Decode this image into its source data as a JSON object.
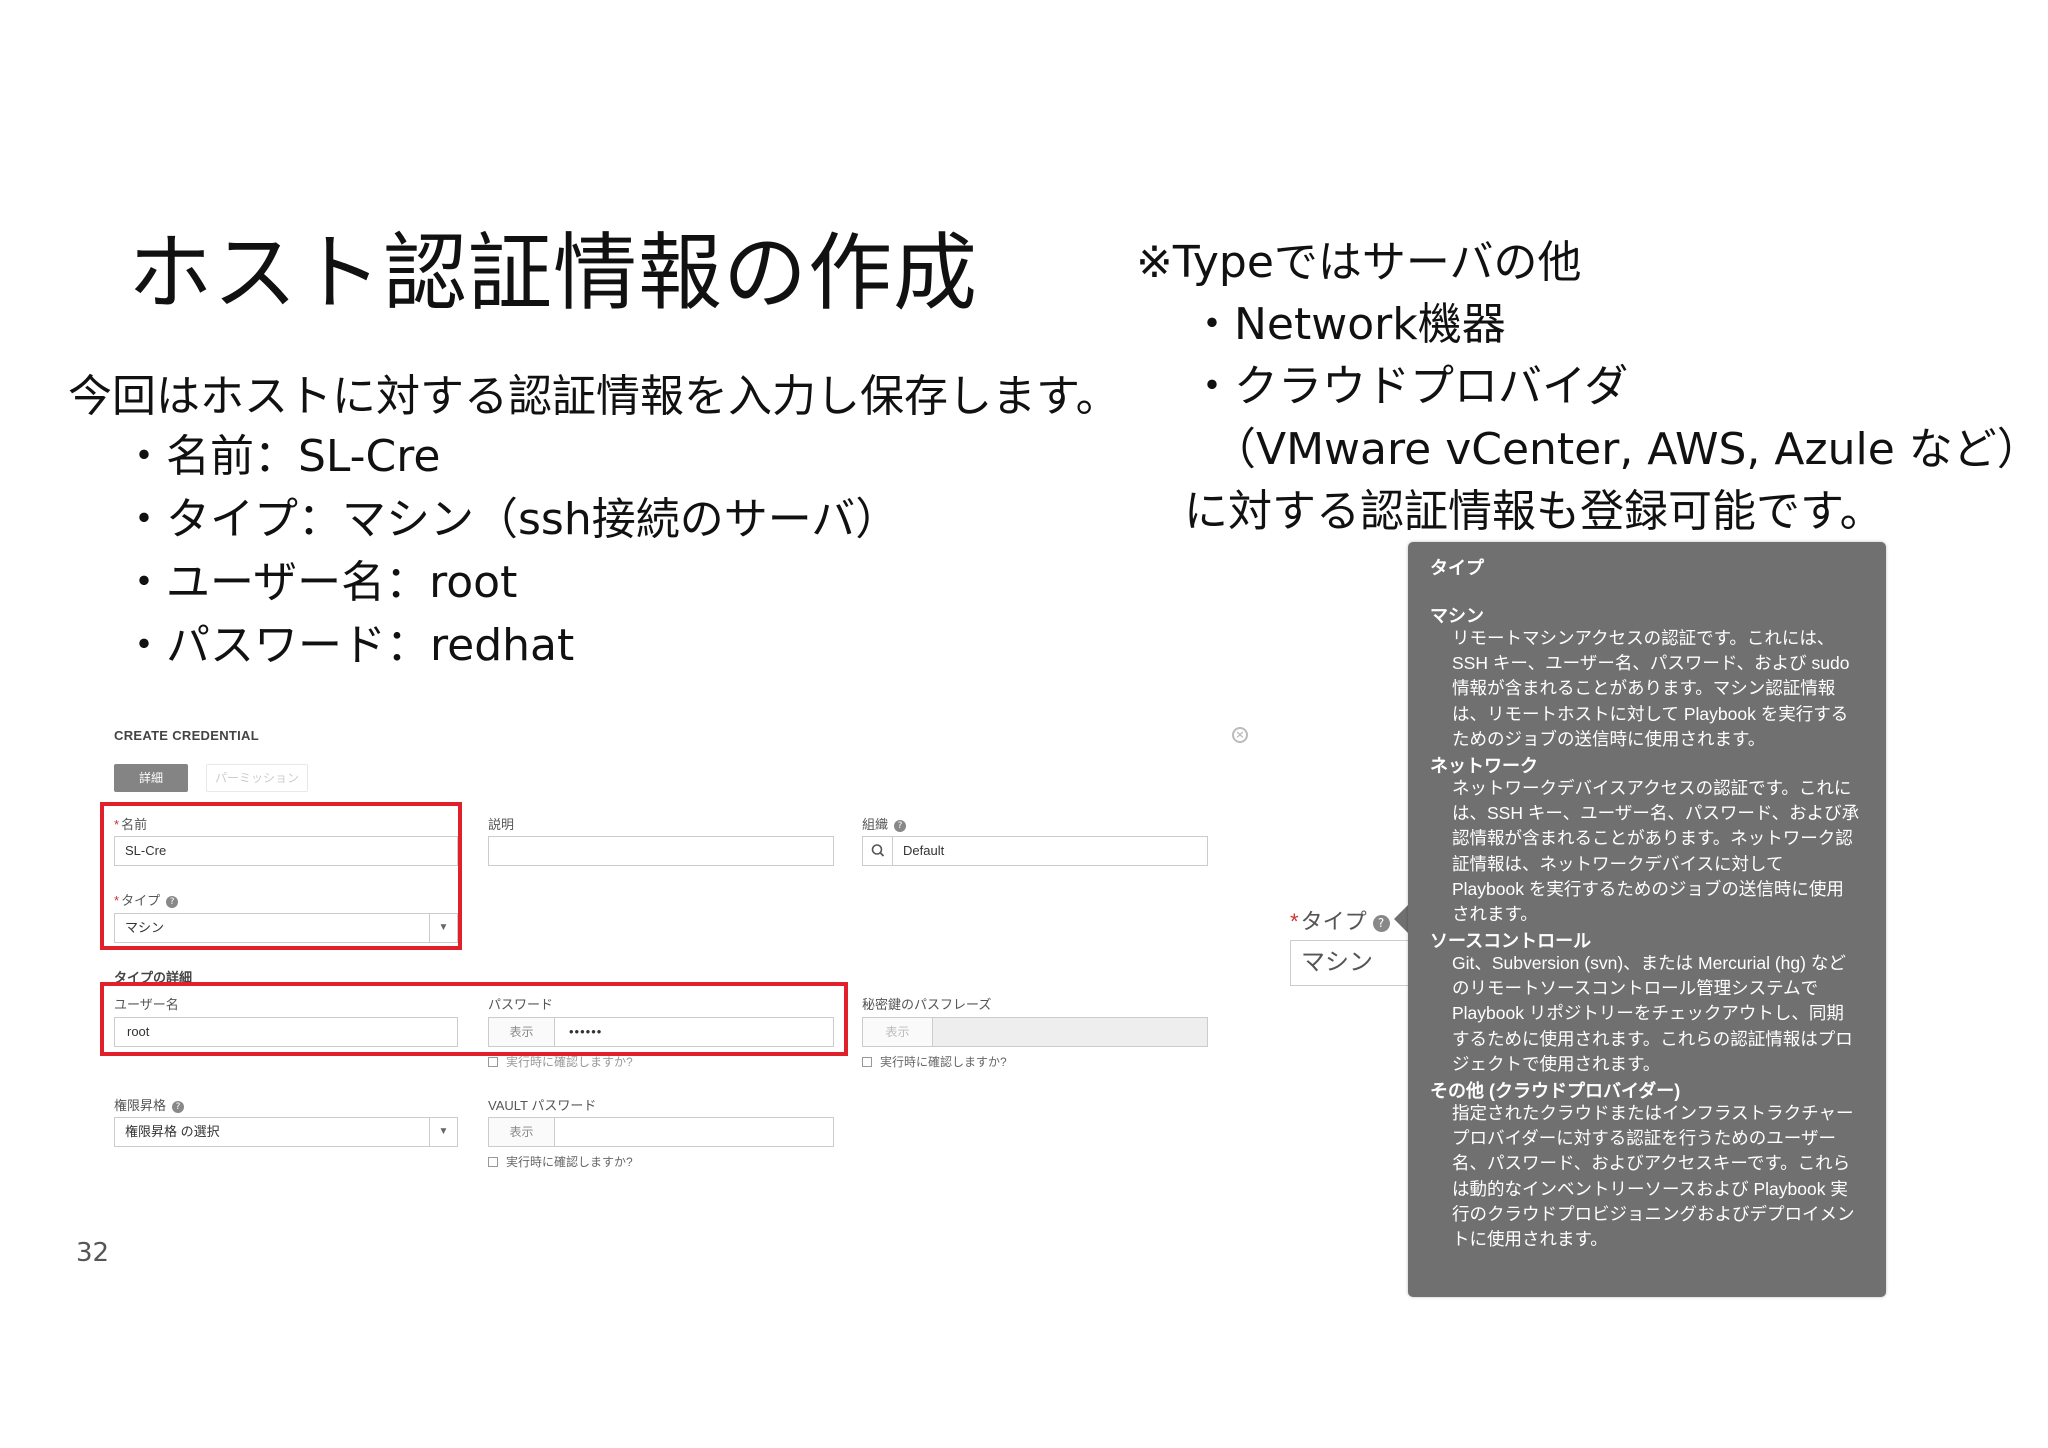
{
  "slide": {
    "title": "ホスト認証情報の作成",
    "intro": "今回はホストに対する認証情報を入力し保存します。",
    "bullets": [
      "・名前：SL-Cre",
      "・タイプ：マシン（ssh接続のサーバ）",
      "・ユーザー名：root",
      "・パスワード：redhat"
    ],
    "note": {
      "title": "※Typeではサーバの他",
      "items": [
        "・Network機器",
        "・クラウドプロバイダ",
        "（VMware vCenter, AWS, Azule など）",
        "に対する認証情報も登録可能です。"
      ]
    },
    "page_number": "32"
  },
  "form": {
    "title": "CREATE CREDENTIAL",
    "tabs": {
      "details": "詳細",
      "permissions": "パーミッション"
    },
    "name": {
      "label": "名前",
      "value": "SL-Cre"
    },
    "description": {
      "label": "説明",
      "value": ""
    },
    "organization": {
      "label": "組織",
      "value": "Default"
    },
    "type": {
      "label": "タイプ",
      "value": "マシン"
    },
    "type_details_heading": "タイプの詳細",
    "username": {
      "label": "ユーザー名",
      "value": "root"
    },
    "password": {
      "label": "パスワード",
      "show_label": "表示",
      "value": "••••••",
      "prompt": "実行時に確認しますか?"
    },
    "ssh_passphrase": {
      "label": "秘密鍵のパスフレーズ",
      "show_label": "表示",
      "prompt": "実行時に確認しますか?"
    },
    "privilege_escalation": {
      "label": "権限昇格",
      "placeholder": "権限昇格 の選択"
    },
    "vault_password": {
      "label": "VAULT パスワード",
      "show_label": "表示",
      "prompt": "実行時に確認しますか?"
    }
  },
  "side_field": {
    "label": "タイプ",
    "value": "マシン"
  },
  "tooltip": {
    "title": "タイプ",
    "sections": [
      {
        "heading": "マシン",
        "body": "リモートマシンアクセスの認証です。これには、\nSSH キー、ユーザー名、パスワード、および sudo\n情報が含まれることがあります。マシン認証情報\nは、リモートホストに対して Playbook を実行する\nためのジョブの送信時に使用されます。"
      },
      {
        "heading": "ネットワーク",
        "body": "ネットワークデバイスアクセスの認証です。これに\nは、SSH キー、ユーザー名、パスワード、および承\n認情報が含まれることがあります。ネットワーク認\n証情報は、ネットワークデバイスに対して\nPlaybook を実行するためのジョブの送信時に使用\nされます。"
      },
      {
        "heading": "ソースコントロール",
        "body": "Git、Subversion (svn)、または Mercurial (hg) など\nのリモートソースコントロール管理システムで\nPlaybook リポジトリーをチェックアウトし、同期\nするために使用されます。これらの認証情報はプロ\nジェクトで使用されます。"
      },
      {
        "heading": "その他 (クラウドプロバイダー)",
        "body": "指定されたクラウドまたはインフラストラクチャー\nプロバイダーに対する認証を行うためのユーザー\n名、パスワード、およびアクセスキーです。これら\nは動的なインベントリーソースおよび Playbook 実\n行のクラウドプロビジョニングおよびデプロイメン\nトに使用されます。"
      }
    ]
  },
  "colors": {
    "highlight": "#e0202a",
    "tooltip_bg": "#707070",
    "active_tab": "#848484"
  }
}
